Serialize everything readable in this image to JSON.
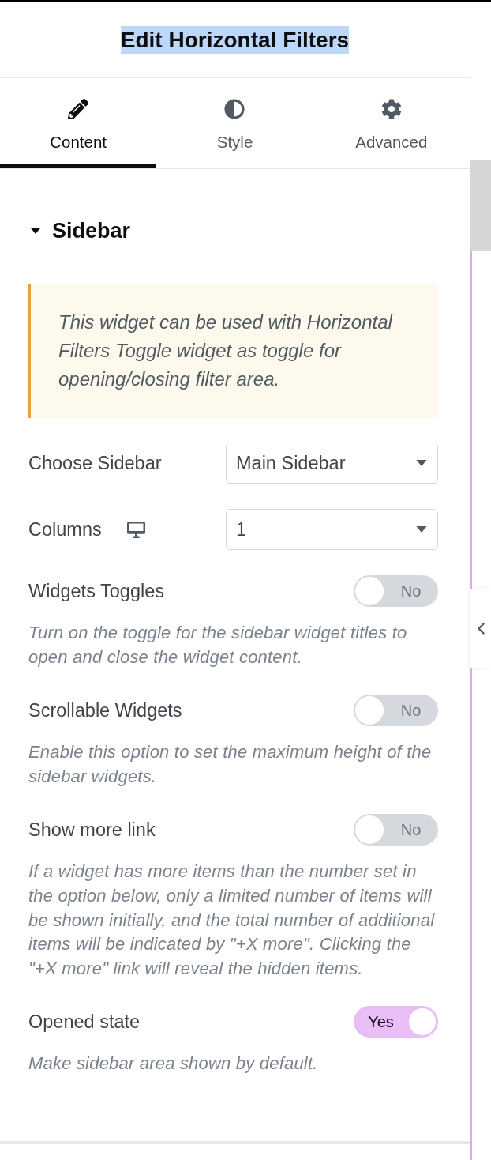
{
  "header": {
    "title": "Edit Horizontal Filters"
  },
  "tabs": [
    {
      "label": "Content",
      "selected": true
    },
    {
      "label": "Style",
      "selected": false
    },
    {
      "label": "Advanced",
      "selected": false
    }
  ],
  "section": {
    "title": "Sidebar",
    "expanded": true
  },
  "notice": {
    "text": "This widget can be used with Horizontal Filters Toggle widget as toggle for opening/closing filter area."
  },
  "controls": [
    {
      "kind": "select",
      "label": "Choose Sidebar",
      "responsive": false,
      "value": "Main Sidebar"
    },
    {
      "kind": "select",
      "label": "Columns",
      "responsive": true,
      "value": "1"
    },
    {
      "kind": "switch",
      "label": "Widgets Toggles",
      "responsive": false,
      "on": false,
      "state_label": "No",
      "description": "Turn on the toggle for the sidebar widget titles to open and close the widget content."
    },
    {
      "kind": "switch",
      "label": "Scrollable Widgets",
      "responsive": false,
      "on": false,
      "state_label": "No",
      "description": "Enable this option to set the maximum height of the sidebar widgets."
    },
    {
      "kind": "switch",
      "label": "Show more link",
      "responsive": false,
      "on": false,
      "state_label": "No",
      "description": "If a widget has more items than the number set in the option below, only a limited number of items will be shown initially, and the total number of additional items will be indicated by \"+X more\". Clicking the \"+X more\" link will reveal the hidden items."
    },
    {
      "kind": "switch",
      "label": "Opened state",
      "responsive": false,
      "on": true,
      "state_label": "Yes",
      "description": "Make sidebar area shown by default."
    }
  ]
}
